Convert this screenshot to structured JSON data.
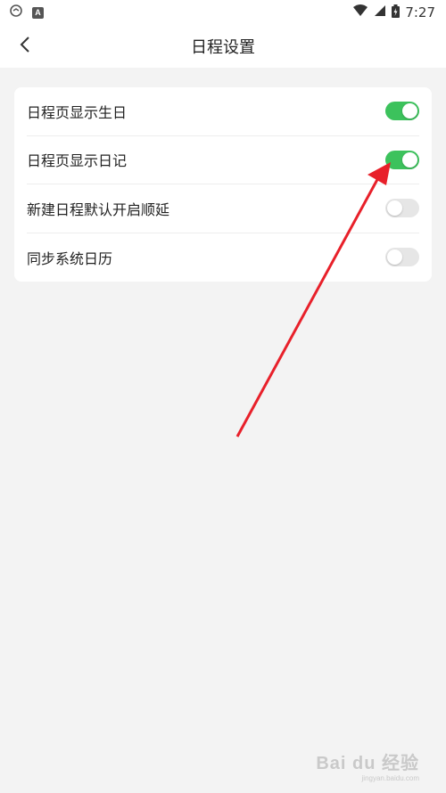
{
  "status_bar": {
    "time": "7:27",
    "left_icons": [
      "app-icon",
      "notification-a-icon"
    ],
    "right_icons": [
      "wifi-icon",
      "signal-icon",
      "battery-icon"
    ],
    "badge_letter": "A"
  },
  "header": {
    "title": "日程设置",
    "back_icon": "chevron-left-icon"
  },
  "settings": [
    {
      "label": "日程页显示生日",
      "enabled": true
    },
    {
      "label": "日程页显示日记",
      "enabled": true
    },
    {
      "label": "新建日程默认开启顺延",
      "enabled": false
    },
    {
      "label": "同步系统日历",
      "enabled": false
    }
  ],
  "colors": {
    "toggle_on": "#3cc25c",
    "toggle_off": "#e6e6e6",
    "annotation_arrow": "#e8202a",
    "background": "#f3f3f3"
  },
  "watermark": {
    "logo": "Bai du 经验",
    "sub": "jingyan.baidu.com"
  }
}
